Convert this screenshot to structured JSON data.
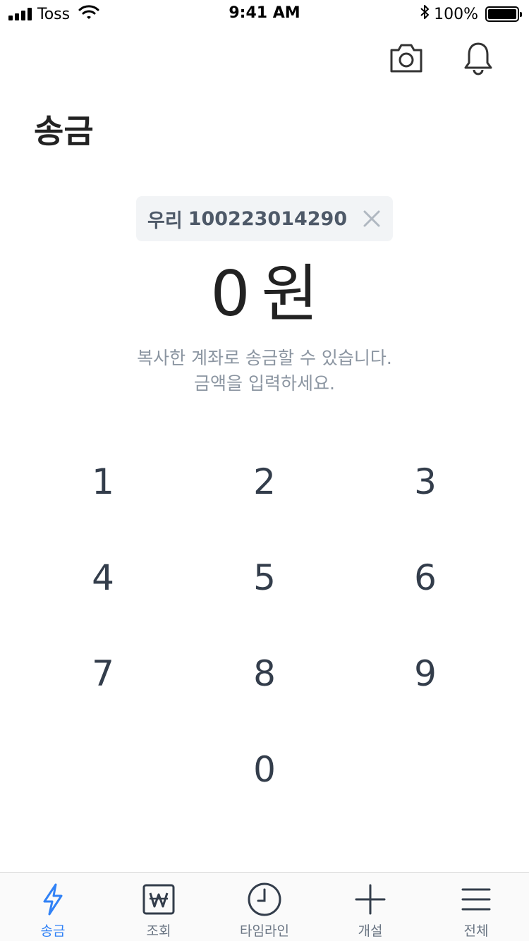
{
  "status_bar": {
    "carrier": "Toss",
    "time": "9:41 AM",
    "battery": "100%"
  },
  "header": {
    "camera_icon": "camera-icon",
    "bell_icon": "bell-icon"
  },
  "page": {
    "title": "송금"
  },
  "account": {
    "bank": "우리",
    "number": "100223014290"
  },
  "amount": {
    "value": "0",
    "unit": "원"
  },
  "hint": {
    "line1": "복사한 계좌로 송금할 수 있습니다.",
    "line2": "금액을 입력하세요."
  },
  "keypad": {
    "keys": [
      "1",
      "2",
      "3",
      "4",
      "5",
      "6",
      "7",
      "8",
      "9",
      "0"
    ]
  },
  "tabs": [
    {
      "label": "송금",
      "icon": "lightning-icon",
      "active": true
    },
    {
      "label": "조회",
      "icon": "won-icon",
      "active": false
    },
    {
      "label": "타임라인",
      "icon": "clock-icon",
      "active": false
    },
    {
      "label": "개설",
      "icon": "plus-icon",
      "active": false
    },
    {
      "label": "전체",
      "icon": "menu-icon",
      "active": false
    }
  ],
  "colors": {
    "accent": "#3182f6",
    "text_primary": "#222222",
    "text_secondary": "#8b95a1",
    "chip_bg": "#f2f4f6"
  }
}
